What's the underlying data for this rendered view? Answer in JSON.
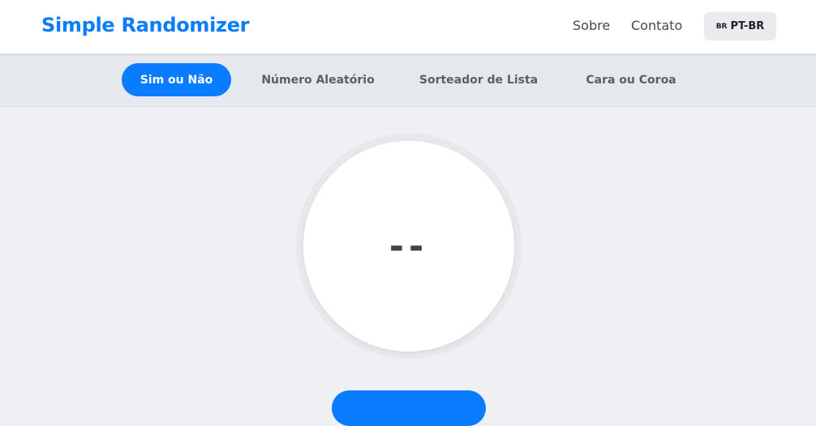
{
  "header": {
    "brand": "Simple Randomizer",
    "nav": {
      "about": "Sobre",
      "contact": "Contato"
    },
    "language": {
      "flag": "BR",
      "label": "PT-BR"
    }
  },
  "tabs": [
    {
      "label": "Sim ou Não",
      "active": true
    },
    {
      "label": "Número Aleatório",
      "active": false
    },
    {
      "label": "Sorteador de Lista",
      "active": false
    },
    {
      "label": "Cara ou Coroa",
      "active": false
    }
  ],
  "result": {
    "value": "--"
  },
  "colors": {
    "accent": "#0a7cff",
    "background": "#eff0f3"
  }
}
